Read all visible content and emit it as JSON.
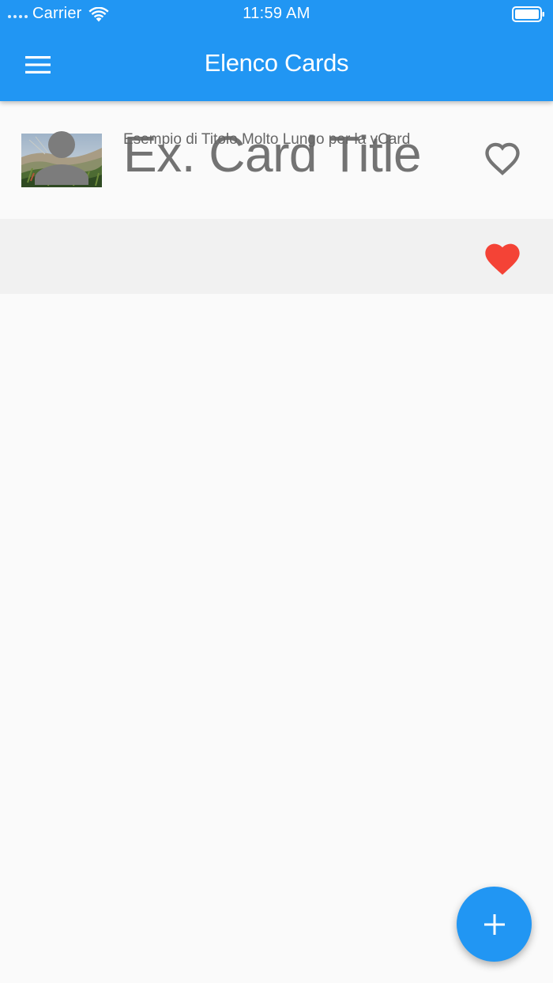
{
  "status_bar": {
    "carrier": "Carrier",
    "time": "11:59 AM",
    "signal_icon": "signal-dots-icon",
    "wifi_icon": "wifi-icon",
    "battery_icon": "battery-icon"
  },
  "app_bar": {
    "title": "Elenco Cards",
    "menu_icon": "hamburger-menu-icon",
    "color": "#2196f3"
  },
  "cards": [
    {
      "title": "Ex. Card Title",
      "thumbnail": "landscape-photo",
      "favorite": false,
      "favorite_icon": "heart-outline-icon"
    },
    {
      "title": "Esempio di Titolo Molto Lungo per la vCard",
      "thumbnail": "person-placeholder-icon",
      "favorite": true,
      "favorite_icon": "heart-filled-icon",
      "favorite_color": "#f44336"
    }
  ],
  "fab": {
    "icon": "plus-icon",
    "color": "#2196f3"
  }
}
